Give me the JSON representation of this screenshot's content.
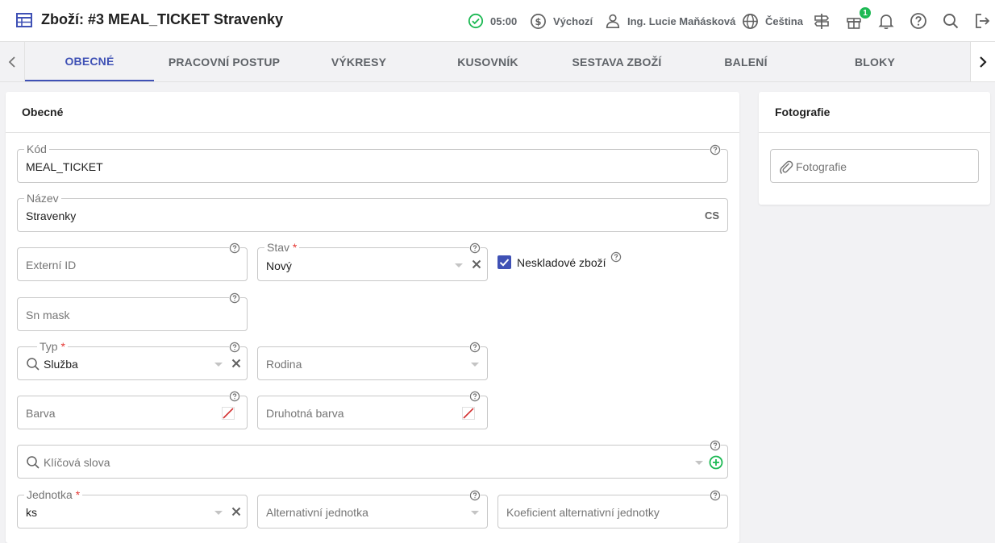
{
  "header": {
    "title": "Zboží: #3 MEAL_TICKET Stravenky",
    "time": "05:00",
    "currency": "Výchozí",
    "user": "Ing. Lucie Maňásková",
    "language": "Čeština",
    "gift_count": "1"
  },
  "tabs": [
    {
      "label": "OBECNÉ"
    },
    {
      "label": "PRACOVNÍ POSTUP"
    },
    {
      "label": "VÝKRESY"
    },
    {
      "label": "KUSOVNÍK"
    },
    {
      "label": "SESTAVA ZBOŽÍ"
    },
    {
      "label": "BALENÍ"
    },
    {
      "label": "BLOKY"
    }
  ],
  "general_card": {
    "title": "Obecné"
  },
  "form": {
    "kod": {
      "label": "Kód",
      "value": "MEAL_TICKET"
    },
    "nazev": {
      "label": "Název",
      "value": "Stravenky",
      "lang": "CS"
    },
    "externi_id": {
      "placeholder": "Externí ID"
    },
    "stav": {
      "label": "Stav",
      "required": "*",
      "value": "Nový"
    },
    "neskladove": {
      "label": "Neskladové zboží",
      "checked": true
    },
    "sn_mask": {
      "placeholder": "Sn mask"
    },
    "typ": {
      "label": "Typ",
      "required": "*",
      "value": "Služba"
    },
    "rodina": {
      "placeholder": "Rodina"
    },
    "barva": {
      "placeholder": "Barva"
    },
    "druhotna_barva": {
      "placeholder": "Druhotná barva"
    },
    "klicova_slova": {
      "placeholder": "Klíčová slova"
    },
    "jednotka": {
      "label": "Jednotka",
      "required": "*",
      "value": "ks"
    },
    "alt_jednotka": {
      "placeholder": "Alternativní jednotka"
    },
    "koeficient": {
      "placeholder": "Koeficient alternativní jednotky"
    }
  },
  "photo_card": {
    "title": "Fotografie",
    "field_placeholder": "Fotografie"
  },
  "colors": {
    "accent": "#3f51b5",
    "success": "#1db954",
    "required": "#e53935"
  },
  "icons": {
    "app": "table-grid-icon",
    "time": "check-circle-icon",
    "currency": "dollar-circle-icon",
    "user": "person-icon",
    "language": "globe-icon",
    "signpost": "signpost-icon",
    "gift": "gift-icon",
    "bell": "bell-icon",
    "help": "help-circle-icon",
    "search": "search-icon",
    "logout": "logout-icon"
  }
}
